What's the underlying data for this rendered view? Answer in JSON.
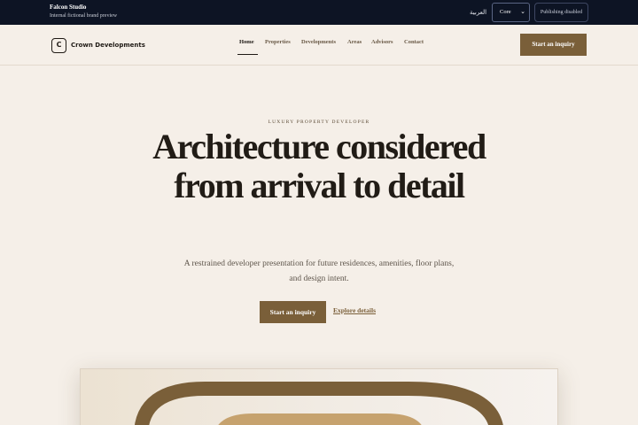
{
  "studio": {
    "title": "Falcon Studio",
    "subtitle": "Internal fictional brand preview",
    "language_link": "العربية",
    "mode_select": "Core",
    "publish_status": "Publishing disabled"
  },
  "brand": {
    "logo_letter": "C",
    "name": "Crown Developments"
  },
  "nav": {
    "items": [
      "Home",
      "Properties",
      "Developments",
      "Areas",
      "Advisors",
      "Contact"
    ],
    "active": "Home",
    "cta": "Start an inquiry"
  },
  "hero": {
    "eyebrow": "LUXURY PROPERTY DEVELOPER",
    "title": "Architecture considered from arrival to detail",
    "description": "A restrained developer presentation for future residences, amenities, floor plans, and design intent.",
    "primary_cta": "Start an inquiry",
    "secondary_cta": "Explore details"
  },
  "colors": {
    "studio_bar": "#0d1424",
    "page_bg": "#f5efe8",
    "accent": "#7a5f39",
    "accent_light": "#c6a26e",
    "text": "#1f1a15"
  },
  "icons": {
    "select_chevron": "chevron-down-icon"
  }
}
